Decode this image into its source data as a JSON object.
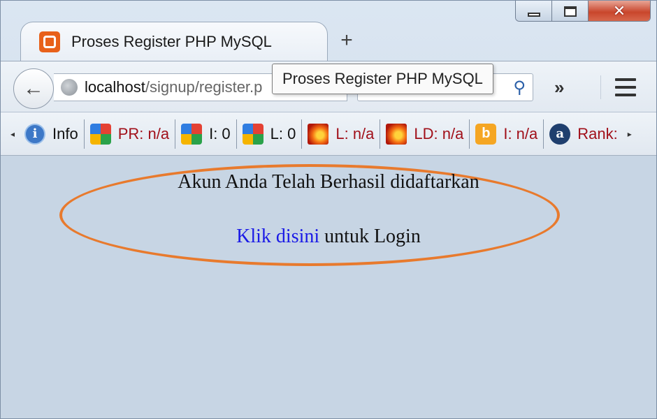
{
  "window": {
    "controls": {
      "minimize": "minimize",
      "maximize": "maximize",
      "close": "✕"
    }
  },
  "tab": {
    "title": "Proses Register PHP MySQL",
    "new_tab_label": "+"
  },
  "navbar": {
    "back_label": "←",
    "url_host": "localhost",
    "url_path": "/signup/register.p",
    "search_glyph": "⚲",
    "overflow_label": "»"
  },
  "tooltip": {
    "text": "Proses Register PHP MySQL"
  },
  "seo_toolbar": {
    "left_arrow": "◂",
    "right_arrow": "▸",
    "items": [
      {
        "icon": "info-icon",
        "label": "Info"
      },
      {
        "icon": "google-icon",
        "label": "PR: n/a"
      },
      {
        "icon": "google-icon",
        "label": "I: 0"
      },
      {
        "icon": "google-icon",
        "label": "L: 0"
      },
      {
        "icon": "flame-icon",
        "label": "L: n/a"
      },
      {
        "icon": "flame-icon",
        "label": "LD: n/a"
      },
      {
        "icon": "bing-icon",
        "label": "I: n/a"
      },
      {
        "icon": "alexa-icon",
        "label": "Rank:"
      }
    ]
  },
  "content": {
    "message": "Akun Anda Telah Berhasil didaftarkan",
    "link_text": "Klik disini",
    "link_suffix": " untuk Login"
  },
  "colors": {
    "highlight_ellipse": "#e87a2d",
    "link": "#1a1ae6",
    "seo_label": "#a1101a",
    "favicon": "#e8611a"
  }
}
